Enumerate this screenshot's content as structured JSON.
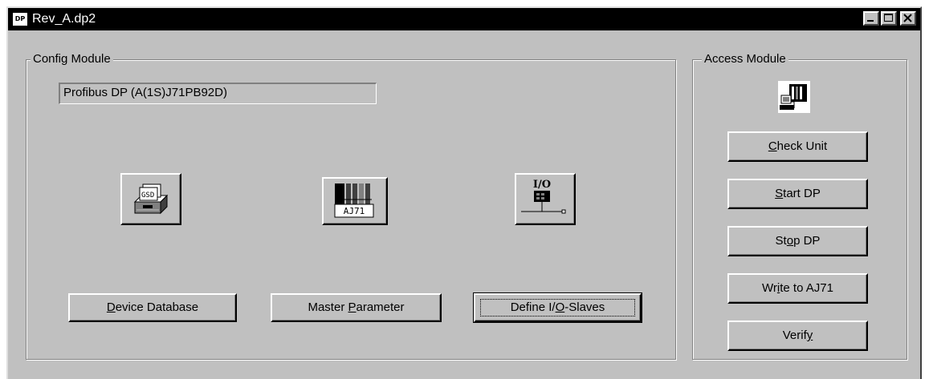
{
  "window": {
    "icon_label": "DP",
    "title": "Rev_A.dp2",
    "controls": {
      "minimize": "minimize-icon",
      "maximize": "maximize-icon",
      "close": "close-icon"
    }
  },
  "config_module": {
    "title": "Config Module",
    "module_name": "Profibus DP (A(1S)J71PB92D)",
    "icons": [
      "gsd-database-icon",
      "aj71-master-icon",
      "io-slave-icon"
    ],
    "icon_texts": {
      "gsd": "GSD",
      "aj71": "AJ71",
      "io": "I/O"
    },
    "buttons": [
      {
        "pre": "",
        "key": "D",
        "post": "evice Database"
      },
      {
        "pre": "Master ",
        "key": "P",
        "post": "arameter"
      },
      {
        "pre": "Define I/",
        "key": "O",
        "post": "-Slaves"
      }
    ]
  },
  "access_module": {
    "title": "Access Module",
    "icon": "access-module-icon",
    "buttons": [
      {
        "pre": "",
        "key": "C",
        "post": "heck Unit"
      },
      {
        "pre": "",
        "key": "S",
        "post": "tart DP"
      },
      {
        "pre": "St",
        "key": "o",
        "post": "p DP"
      },
      {
        "pre": "Wr",
        "key": "i",
        "post": "te to AJ71"
      },
      {
        "pre": "Verif",
        "key": "y",
        "post": ""
      }
    ]
  },
  "colors": {
    "face": "#c0c0c0",
    "titlebar": "#000000",
    "shadow": "#808080",
    "highlight": "#ffffff"
  }
}
